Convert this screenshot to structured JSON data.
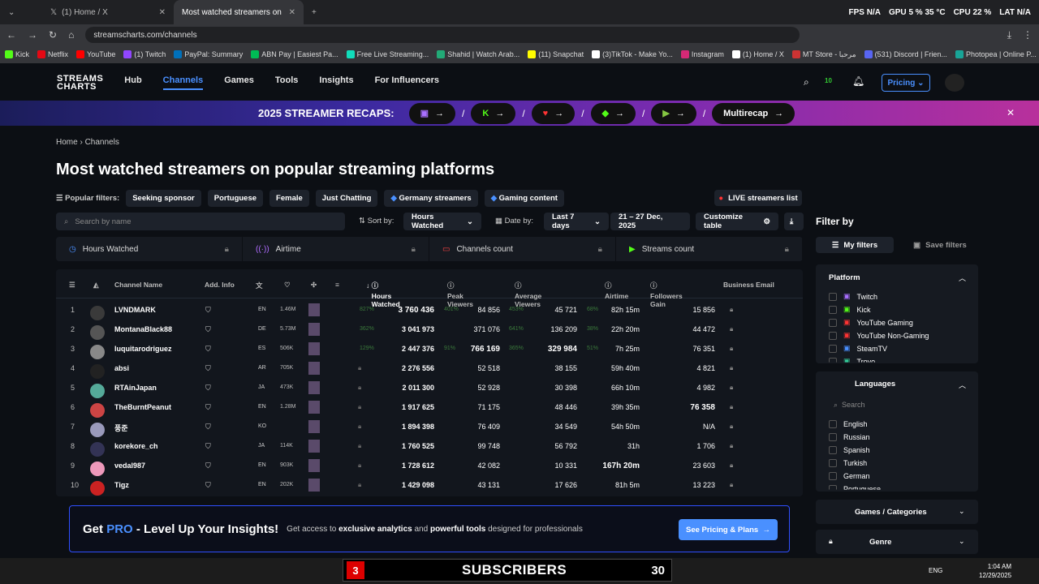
{
  "browser": {
    "tabs": [
      {
        "title": "(1) Home / X"
      },
      {
        "title": "Most watched streamers on po"
      }
    ],
    "url": "streamscharts.com/channels"
  },
  "hud": {
    "fps_label": "FPS",
    "fps": "N/A",
    "gpu_label": "GPU",
    "gpu": "5 %",
    "gpu_temp": "35 °C",
    "cpu_label": "CPU",
    "cpu": "22 %",
    "lat_label": "LAT",
    "lat": "N/A"
  },
  "bookmarks": [
    "Kick",
    "Netflix",
    "YouTube",
    "(1) Twitch",
    "PayPal: Summary",
    "ABN Pay | Easiest Pa...",
    "Free Live Streaming...",
    "Shahid | Watch Arab...",
    "(11) Snapchat",
    "(3)TikTok - Make Yo...",
    "Instagram",
    "(1) Home / X",
    "MT Store - مرحبا",
    "(531) Discord | Frien...",
    "Photopea | Online P..."
  ],
  "site": {
    "logo_top": "STREAMS",
    "logo_bottom": "CHARTS",
    "nav": [
      "Hub",
      "Channels",
      "Games",
      "Tools",
      "Insights",
      "For Influencers"
    ],
    "pricing": "Pricing",
    "badge": "10"
  },
  "banner": {
    "title": "2025 STREAMER RECAPS:",
    "last": "Multirecap",
    "sep": "/"
  },
  "page": {
    "breadcrumb_home": "Home",
    "breadcrumb_current": "Channels",
    "title": "Most watched streamers on popular streaming platforms",
    "popular_label": "Popular filters:",
    "chips": [
      "Seeking sponsor",
      "Portuguese",
      "Female",
      "Just Chatting",
      "Germany streamers",
      "Gaming content"
    ],
    "live_btn": "LIVE streamers list",
    "search_placeholder": "Search by name",
    "sort_label": "Sort by:",
    "sort_value": "Hours Watched",
    "date_label": "Date by:",
    "date_value": "Last 7 days",
    "date_range": "21 – 27 Dec, 2025",
    "customize": "Customize table"
  },
  "metric_tabs": [
    "Hours Watched",
    "Airtime",
    "Channels count",
    "Streams count"
  ],
  "columns": {
    "name": "Channel Name",
    "info": "Add. Info",
    "hours": "Hours Watched",
    "peak": "Peak Viewers",
    "avg": "Average Viewers",
    "airtime": "Airtime",
    "followers": "Followers Gain",
    "email": "Business Email"
  },
  "rows": [
    {
      "rank": "1",
      "name": "LVNDMARK",
      "lang": "EN",
      "subs": "1.46M",
      "hours": "3 760 436",
      "hours_pct": "827%",
      "peak": "84 856",
      "peak_pct": "401%",
      "avg": "45 721",
      "avg_pct": "453%",
      "airtime": "82h 15m",
      "air_pct": "68%",
      "followers": "15 856"
    },
    {
      "rank": "2",
      "name": "MontanaBlack88",
      "lang": "DE",
      "subs": "5.73M",
      "hours": "3 041 973",
      "hours_pct": "362%",
      "peak": "371 076",
      "peak_pct": "",
      "avg": "136 209",
      "avg_pct": "641%",
      "airtime": "22h 20m",
      "air_pct": "38%",
      "followers": "44 472"
    },
    {
      "rank": "3",
      "name": "luquitarodriguez",
      "lang": "ES",
      "subs": "506K",
      "hours": "2 447 376",
      "hours_pct": "129%",
      "peak": "766 169",
      "peak_pct": "91%",
      "avg": "329 984",
      "avg_pct": "365%",
      "airtime": "7h 25m",
      "air_pct": "51%",
      "followers": "76 351"
    },
    {
      "rank": "4",
      "name": "absi",
      "lang": "AR",
      "subs": "705K",
      "hours": "2 276 556",
      "peak": "52 518",
      "avg": "38 155",
      "airtime": "59h 40m",
      "followers": "4 821"
    },
    {
      "rank": "5",
      "name": "RTAinJapan",
      "lang": "JA",
      "subs": "473K",
      "hours": "2 011 300",
      "peak": "52 928",
      "avg": "30 398",
      "airtime": "66h 10m",
      "followers": "4 982"
    },
    {
      "rank": "6",
      "name": "TheBurntPeanut",
      "lang": "EN",
      "subs": "1.28M",
      "hours": "1 917 625",
      "peak": "71 175",
      "avg": "48 446",
      "airtime": "39h 35m",
      "followers": "76 358"
    },
    {
      "rank": "7",
      "name": "풍준",
      "lang": "KO",
      "subs": "",
      "hours": "1 894 398",
      "peak": "76 409",
      "avg": "34 549",
      "airtime": "54h 50m",
      "followers": "N/A"
    },
    {
      "rank": "8",
      "name": "korekore_ch",
      "lang": "JA",
      "subs": "114K",
      "hours": "1 760 525",
      "peak": "99 748",
      "avg": "56 792",
      "airtime": "31h",
      "followers": "1 706"
    },
    {
      "rank": "9",
      "name": "vedal987",
      "lang": "EN",
      "subs": "903K",
      "hours": "1 728 612",
      "peak": "42 082",
      "avg": "10 331",
      "airtime": "167h 20m",
      "followers": "23 603"
    },
    {
      "rank": "10",
      "name": "Tigz",
      "lang": "EN",
      "subs": "202K",
      "hours": "1 429 098",
      "peak": "43 131",
      "avg": "17 626",
      "airtime": "81h 5m",
      "followers": "13 223"
    }
  ],
  "sidebar": {
    "title": "Filter by",
    "my_filters": "My filters",
    "save_filters": "Save filters",
    "platform": "Platform",
    "platforms": [
      "Twitch",
      "Kick",
      "YouTube Gaming",
      "YouTube Non-Gaming",
      "SteamTV",
      "Trovo"
    ],
    "languages_title": "Languages",
    "lang_search": "Search",
    "languages": [
      "English",
      "Russian",
      "Spanish",
      "Turkish",
      "German",
      "Portuguese"
    ],
    "games": "Games / Categories",
    "genre": "Genre"
  },
  "pro": {
    "prefix": "Get ",
    "pro": "PRO",
    "title_rest": " - Level Up Your Insights!",
    "sub_a": "Get access to ",
    "sub_b": "exclusive analytics",
    "sub_c": " and ",
    "sub_d": "powerful tools",
    "sub_e": " designed for professionals",
    "button": "See Pricing & Plans"
  },
  "taskbar": {
    "left_num": "3",
    "subs": "SUBSCRIBERS",
    "right_num": "30",
    "time": "1:04 AM",
    "date": "12/29/2025",
    "lang": "ENG"
  }
}
